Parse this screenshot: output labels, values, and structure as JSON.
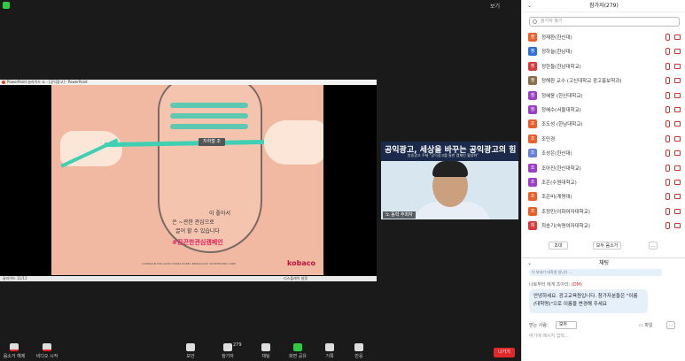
{
  "top": {
    "view_label": "보기"
  },
  "share": {
    "title": "PowerPoint 슬라이드 쇼 - [공익광고] - PowerPoint",
    "slide": {
      "tag_label": "지하철 조",
      "line1": "이 좋아서",
      "line2": "은 ~관한 관심으로",
      "line3": "끌어 할 수 있습니다",
      "hashtag": "#끈끈한관심캠페인",
      "footer": "CAMPAIGN FOR GOOD KOREA  KOREA BROADCAST ADVERTISING CORP",
      "logo": "kobaco"
    },
    "status_left": "슬라이드 11/13",
    "status_right": "디스플레이 설정"
  },
  "video": {
    "banner": "공익광고, 세상을 바꾸는 공익광고의 힘",
    "sub": "방송광고 주제 \"공익광고를 통한 캠페인 활성화\"",
    "name": "노 동혁 주최자"
  },
  "toolbar": {
    "items": [
      {
        "label": "음소거 해제",
        "icon": "mic-off-icon"
      },
      {
        "label": "비디오 시작",
        "icon": "video-off-icon"
      },
      {
        "label": "보안",
        "icon": "shield-icon"
      },
      {
        "label": "참가자",
        "icon": "participants-icon",
        "count": "279"
      },
      {
        "label": "채팅",
        "icon": "chat-icon"
      },
      {
        "label": "화면 공유",
        "icon": "share-screen-icon"
      },
      {
        "label": "기록",
        "icon": "record-icon"
      },
      {
        "label": "반응",
        "icon": "reaction-icon"
      }
    ],
    "leave_label": "나가기"
  },
  "panel": {
    "title": "참가자(279)",
    "search_placeholder": "참가자 찾기",
    "participants": [
      {
        "initial": "정",
        "name": "정재환(한신대)",
        "color": "#e8612c"
      },
      {
        "initial": "정",
        "name": "정하늘(한남대)",
        "color": "#2f6fd6"
      },
      {
        "initial": "정",
        "name": "정한들(한남대학교)",
        "color": "#d63a3a"
      },
      {
        "initial": "정",
        "name": "정해환 교수 (고신대학교 광고홍보학과)",
        "color": "#8a6d4a"
      },
      {
        "initial": "정",
        "name": "정혜윤 (한신대학교)",
        "color": "#9b3fc7"
      },
      {
        "initial": "정",
        "name": "정혜수(서울대학교)",
        "color": "#9b3fc7"
      },
      {
        "initial": "조",
        "name": "조도성 (한남대학교)",
        "color": "#e8612c"
      },
      {
        "initial": "조",
        "name": "조민경",
        "color": "#e8612c"
      },
      {
        "initial": "조",
        "name": "조성은(한신대)",
        "color": "#6b7fd6"
      },
      {
        "initial": "조",
        "name": "조아진(한신대학교)",
        "color": "#9b3fc7"
      },
      {
        "initial": "조",
        "name": "조은(수원대학교)",
        "color": "#9b3fc7"
      },
      {
        "initial": "조",
        "name": "조은비(계명대)",
        "color": "#e8612c"
      },
      {
        "initial": "조",
        "name": "조정민(이화여자대학교)",
        "color": "#e8612c"
      },
      {
        "initial": "최",
        "name": "최송기(숙명여자대학교)",
        "color": "#d63a3a"
      }
    ],
    "invite_label": "초대",
    "mute_all_label": "모두 음소거",
    "more_label": "...",
    "chat_title": "채팅",
    "prev_msg_fragment": "이 보내기 대학생 입니다 ...",
    "msg_meta_prefix": "나로부터 에게 조아라:",
    "msg_meta_dm": "(DM)",
    "msg_body": "안녕하세요. 광고교육원입니다. 참가자분들은 \"이름(대학명)\"으로 이름을 변경해 주세요",
    "to_label": "받는 사람:",
    "to_value": "모두",
    "file_label": "파일",
    "chat_placeholder": "여기에 메시지 입력..."
  }
}
